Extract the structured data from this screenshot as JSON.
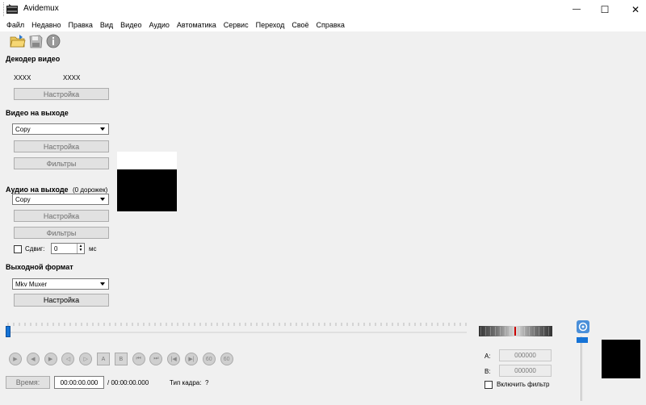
{
  "window": {
    "title": "Avidemux",
    "minimize_glyph": "—",
    "maximize_glyph": "☐",
    "close_glyph": "✕"
  },
  "menu": [
    "Файл",
    "Недавно",
    "Правка",
    "Вид",
    "Видео",
    "Аудио",
    "Автоматика",
    "Сервис",
    "Переход",
    "Своё",
    "Справка"
  ],
  "toolbar": {
    "icons": [
      "open-folder-icon",
      "save-disk-icon",
      "info-icon"
    ]
  },
  "decoder": {
    "title": "Декодер видео",
    "value_a": "XXXX",
    "value_b": "XXXX",
    "configure_label": "Настройка"
  },
  "video_output": {
    "title": "Видео на выходе",
    "codec": "Copy",
    "configure_label": "Настройка",
    "filters_label": "Фильтры"
  },
  "audio_output": {
    "title": "Аудио на выходе",
    "tracks": "(0 дорожек)",
    "codec": "Copy",
    "configure_label": "Настройка",
    "filters_label": "Фильтры",
    "shift_label": "Сдвиг:",
    "shift_value": "0",
    "shift_unit": "мс"
  },
  "output_format": {
    "title": "Выходной формат",
    "muxer": "Mkv Muxer",
    "configure_label": "Настройка"
  },
  "navigation": {
    "time_button_label": "Время:",
    "current_time": "00:00:00.000",
    "total_time": "/ 00:00:00.000",
    "frame_type_label": "Тип кадра:",
    "frame_type_value": "?",
    "buttons": [
      "play-icon",
      "rewind-icon",
      "forward-icon",
      "previous-frame-icon",
      "next-frame-icon",
      "set-marker-a-icon",
      "set-marker-b-icon",
      "previous-cut-icon",
      "next-cut-icon",
      "go-to-start-icon",
      "go-to-end-icon",
      "back-60s-icon",
      "forward-60s-icon"
    ]
  },
  "selection": {
    "a_label": "A:",
    "a_value": "000000",
    "b_label": "B:",
    "b_value": "000000",
    "filter_checkbox_label": "Включить фильтр"
  },
  "colors": {
    "accent": "#1573d6",
    "background": "#f0f0f0",
    "marker": "#cc0000"
  }
}
